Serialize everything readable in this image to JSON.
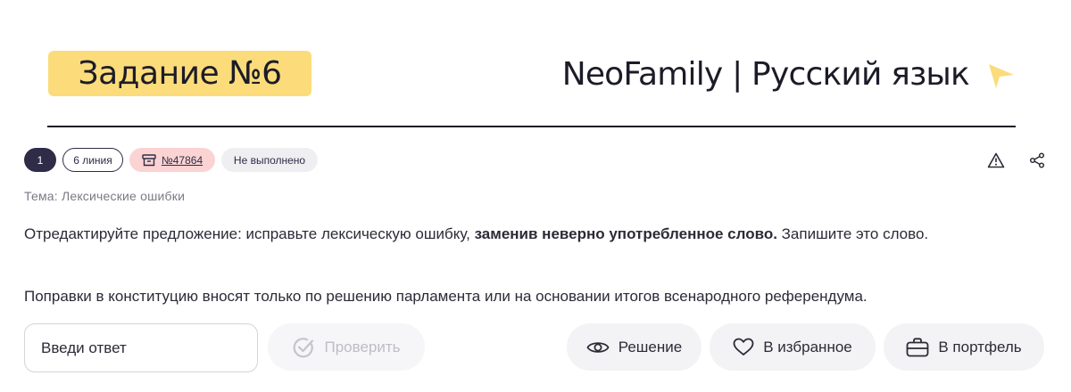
{
  "header": {
    "task_title": "Задание №6",
    "brand_title": "NeoFamily | Русский язык"
  },
  "chips": {
    "number": "1",
    "line": "6 линия",
    "task_id": "№47864",
    "status": "Не выполнено"
  },
  "topic": "Тема: Лексические ошибки",
  "instruction": {
    "part1": "Отредактируйте предложение: исправьте лексическую ошибку, ",
    "bold": "заменив неверно употребленное слово.",
    "part2": " Запишите это слово."
  },
  "sentence": "Поправки в конституцию вносят только по решению парламента или на основании итогов всенародного референдума.",
  "answer": {
    "placeholder": "Введи ответ",
    "value": ""
  },
  "buttons": {
    "check": "Проверить",
    "solution": "Решение",
    "favorite": "В избранное",
    "portfolio": "В портфель"
  },
  "colors": {
    "task_badge": "#fcdc7a",
    "brand_arrow": "#fcdc7a",
    "dark_chip": "#2e2c47",
    "id_chip": "#fbd3d3",
    "status_chip": "#efeff2",
    "button_bg": "#f3f3f5"
  },
  "icons": {
    "brand": "send-arrow-icon",
    "task_id": "archive-box-icon",
    "report": "warning-triangle-icon",
    "share": "share-icon",
    "check": "check-circle-icon",
    "solution": "eye-icon",
    "favorite": "heart-icon",
    "portfolio": "briefcase-icon"
  }
}
